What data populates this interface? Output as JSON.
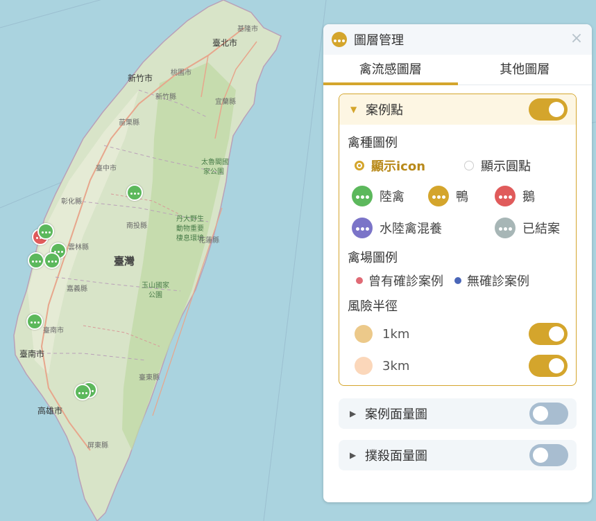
{
  "map": {
    "labels": {
      "keelung": "基隆市",
      "taipei": "臺北市",
      "taoyuan": "桃園市",
      "hsinchu_city": "新竹市",
      "hsinchu_county": "新竹縣",
      "yilan": "宜蘭縣",
      "miaoli": "苗栗縣",
      "taichung": "臺中市",
      "changhua": "彰化縣",
      "nantou": "南投縣",
      "yunlin": "雲林縣",
      "chiayi": "嘉義縣",
      "tainan": "臺南市",
      "tainan2": "臺南市",
      "kaohsiung": "高雄市",
      "pingtung": "屏東縣",
      "hualien": "花蓮縣",
      "taitung": "臺東縣",
      "taiwan": "臺灣",
      "taroko_1": "太魯閣國",
      "taroko_2": "家公園",
      "danda_1": "丹大野生",
      "danda_2": "動物重要",
      "danda_3": "棲息環境",
      "yushan_1": "玉山國家",
      "yushan_2": "公園"
    },
    "markers": [
      {
        "color": "#5cb85c"
      },
      {
        "color": "#e05b5b"
      },
      {
        "color": "#5cb85c"
      },
      {
        "color": "#5cb85c"
      },
      {
        "color": "#5cb85c"
      },
      {
        "color": "#5cb85c"
      },
      {
        "color": "#5cb85c"
      },
      {
        "color": "#5cb85c"
      },
      {
        "color": "#5cb85c"
      }
    ]
  },
  "panel": {
    "title": "圖層管理",
    "close_icon": "×",
    "tabs": [
      {
        "label": "禽流感圖層",
        "active": true
      },
      {
        "label": "其他圖層",
        "active": false
      }
    ],
    "case_points": {
      "label": "案例點",
      "enabled": true,
      "species_legend_title": "禽種圖例",
      "display_options": [
        {
          "label": "顯示icon",
          "checked": true
        },
        {
          "label": "顯示圓點",
          "checked": false
        }
      ],
      "species": [
        {
          "label": "陸禽",
          "color": "#5cb85c"
        },
        {
          "label": "鴨",
          "color": "#d4a52c"
        },
        {
          "label": "鵝",
          "color": "#e05b5b"
        },
        {
          "label": "水陸禽混養",
          "color": "#7b74c8"
        },
        {
          "label": "已結案",
          "color": "#a7b6b6"
        }
      ],
      "farm_legend_title": "禽場圖例",
      "farms": [
        {
          "label": "曾有確診案例",
          "color": "#e06a75"
        },
        {
          "label": "無確診案例",
          "color": "#4a66b8"
        }
      ],
      "radius_title": "風險半徑",
      "radii": [
        {
          "label": "1km",
          "color": "#ecc98a",
          "enabled": true
        },
        {
          "label": "3km",
          "color": "#fbd7ba",
          "enabled": true
        }
      ]
    },
    "case_area": {
      "label": "案例面量圖",
      "enabled": false
    },
    "cull_area": {
      "label": "撲殺面量圖",
      "enabled": false
    }
  }
}
